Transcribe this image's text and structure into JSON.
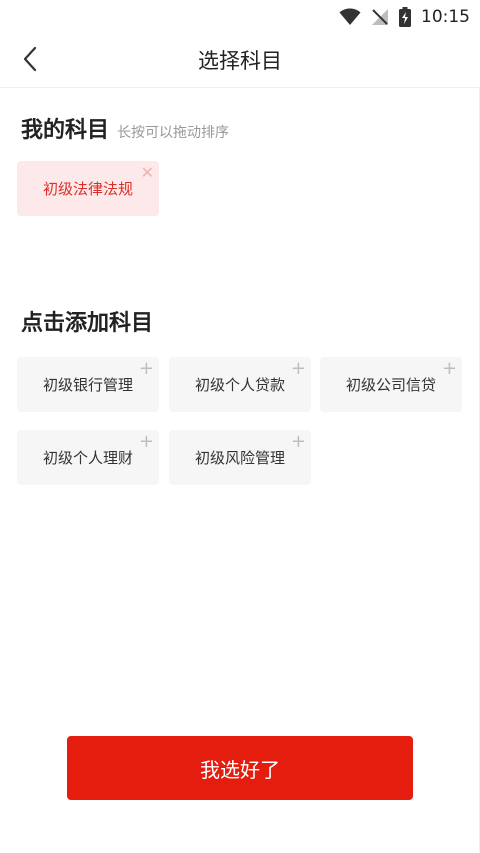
{
  "status_bar": {
    "time": "10:15"
  },
  "header": {
    "title": "选择科目"
  },
  "my_subjects": {
    "title": "我的科目",
    "hint": "长按可以拖动排序",
    "items": [
      {
        "label": "初级法律法规"
      }
    ]
  },
  "add_subjects": {
    "title": "点击添加科目",
    "items": [
      {
        "label": "初级银行管理"
      },
      {
        "label": "初级个人贷款"
      },
      {
        "label": "初级公司信贷"
      },
      {
        "label": "初级个人理财"
      },
      {
        "label": "初级风险管理"
      }
    ]
  },
  "confirm_button": {
    "label": "我选好了"
  },
  "colors": {
    "accent": "#e41d0f",
    "selected_bg": "#fde9e9",
    "selected_text": "#d9302a",
    "chip_bg": "#f6f6f6"
  },
  "icons": {
    "back": "chevron-left-icon",
    "add": "plus-icon",
    "remove": "close-icon",
    "wifi": "wifi-icon",
    "signal": "no-signal-icon",
    "battery": "battery-charging-icon"
  }
}
